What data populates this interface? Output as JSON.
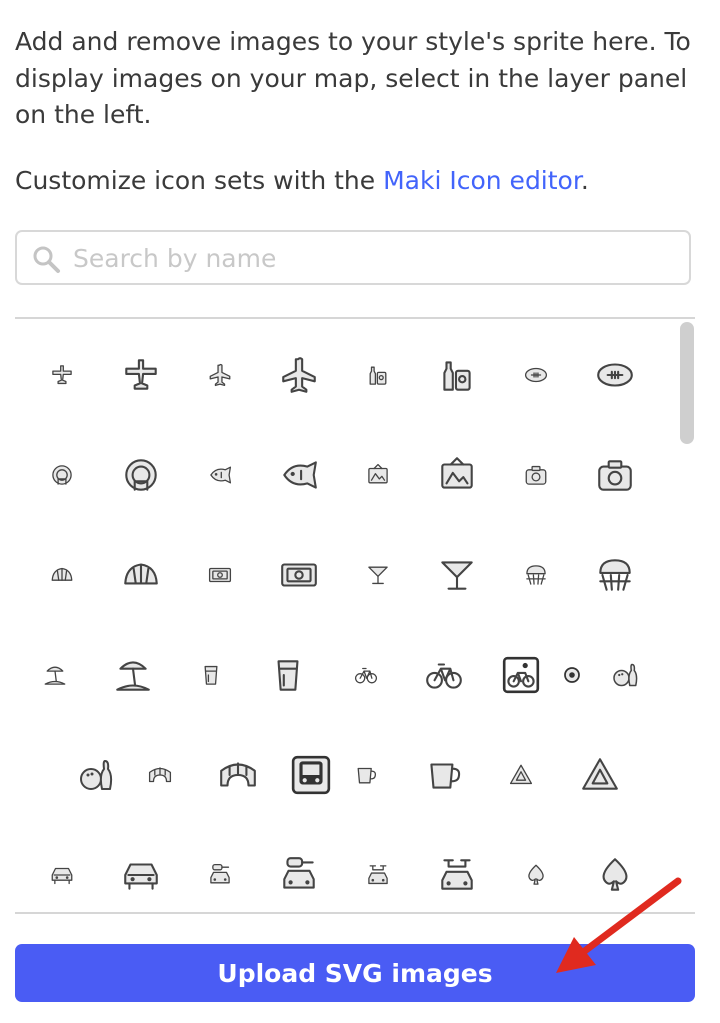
{
  "intro": {
    "text": "Add and remove images to your style's sprite here. To display images on your map, select in the layer panel on the left.",
    "customize_prefix": "Customize icon sets with the ",
    "customize_link": "Maki Icon editor",
    "customize_suffix": "."
  },
  "search": {
    "placeholder": "Search by name",
    "value": ""
  },
  "icons": [
    [
      "airfield-icon",
      "airfield-icon",
      "airport-icon",
      "airport-icon",
      "alcohol-shop-icon",
      "alcohol-shop-icon",
      "american-football-icon",
      "american-football-icon"
    ],
    [
      "aquarium-icon",
      "aquarium-icon",
      "aquarium-fish-icon",
      "aquarium-fish-icon",
      "art-gallery-icon",
      "art-gallery-icon",
      "attraction-icon",
      "attraction-icon"
    ],
    [
      "bakery-icon",
      "bakery-icon",
      "bank-icon",
      "bank-icon",
      "bar-icon",
      "bar-icon",
      "basketball-icon",
      "basketball-icon"
    ],
    [
      "beach-icon",
      "beach-icon",
      "beer-icon",
      "beer-icon",
      "bicycle-icon",
      "bicycle-icon",
      "bicycle-share-icon",
      "dot-icon",
      "bowling-icon"
    ],
    [
      "bowling-icon",
      "bridge-icon",
      "bridge-icon",
      "bus-icon",
      "cafe-icon",
      "cafe-icon",
      "caution-icon",
      "caution-icon"
    ],
    [
      "car-icon",
      "car-icon",
      "car-rental-icon",
      "car-rental-icon",
      "car-repair-icon",
      "car-repair-icon",
      "cardgame-icon",
      "cardgame-icon"
    ]
  ],
  "upload_button": {
    "label": "Upload SVG images"
  },
  "annotation": {
    "arrow_color": "#e02a1f"
  }
}
